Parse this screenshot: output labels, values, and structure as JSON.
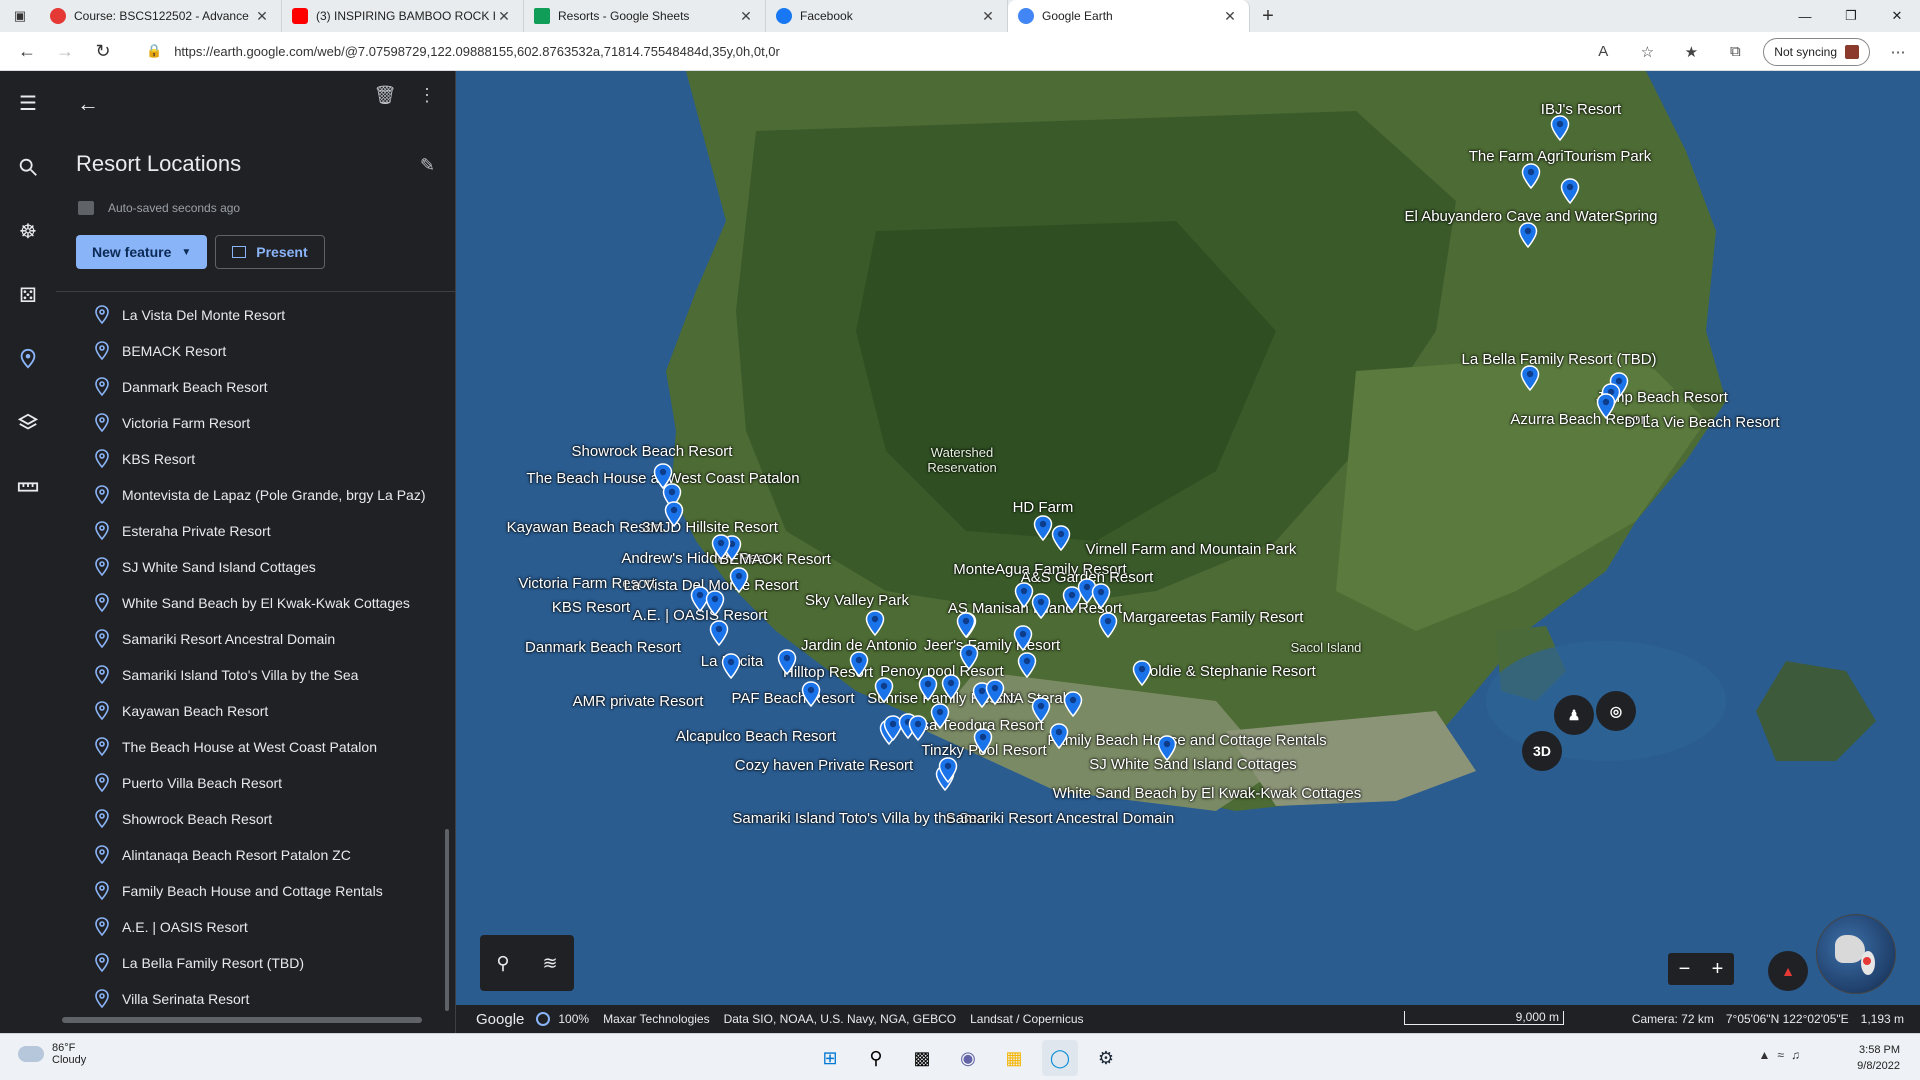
{
  "browser": {
    "tabs": [
      {
        "title": "Course: BSCS122502 - Advance",
        "favicon_color": "#e53935"
      },
      {
        "title": "(3) INSPIRING BAMBOO ROCK H",
        "favicon_color": "#ff0000"
      },
      {
        "title": "Resorts - Google Sheets",
        "favicon_color": "#0f9d58"
      },
      {
        "title": "Facebook",
        "favicon_color": "#1877f2"
      },
      {
        "title": "Google Earth",
        "favicon_color": "#4285f4"
      }
    ],
    "url": "https://earth.google.com/web/@7.07598729,122.09888155,602.8763532a,71814.75548484d,35y,0h,0t,0r",
    "sync_label": "Not syncing"
  },
  "panel": {
    "project_title": "Resort Locations",
    "autosave": "Auto-saved seconds ago",
    "new_feature_label": "New feature",
    "present_label": "Present",
    "features": [
      "La Vista Del Monte Resort",
      "BEMACK Resort",
      "Danmark Beach Resort",
      "Victoria Farm Resort",
      "KBS Resort",
      "Montevista de Lapaz (Pole Grande, brgy La Paz)",
      "Esteraha Private Resort",
      "SJ White Sand Island Cottages",
      "White Sand Beach by El Kwak-Kwak Cottages",
      "Samariki Resort Ancestral Domain",
      "Samariki Island Toto's Villa by the Sea",
      "Kayawan Beach Resort",
      "The Beach House at West Coast Patalon",
      "Puerto Villa Beach Resort",
      "Showrock Beach Resort",
      "Alintanaqa Beach Resort Patalon ZC",
      "Family Beach House and Cottage Rentals",
      "A.E. | OASIS Resort",
      "La Bella Family Resort (TBD)",
      "Villa Serinata Resort"
    ]
  },
  "map": {
    "labels": [
      "IBJ's Resort",
      "The Farm AgriTourism Park",
      "El Abuyandero Cave and WaterSpring",
      "La Bella Family Resort (TBD)",
      "Jemp Beach Resort",
      "Azurra Beach Resort",
      "D' La Vie Beach Resort",
      "Showrock Beach Resort",
      "The Beach House at West Coast Patalon",
      "Kayawan Beach Resort",
      "3MJD Hillsite Resort",
      "Andrew's Hidden Resort",
      "BEMACK Resort",
      "HD Farm",
      "Virnell Farm and Mountain Park",
      "MonteAgua Family Resort",
      "A&S Garden Resort",
      "Victoria Farm Resort",
      "La Vista Del Monte Resort",
      "Sky Valley Park",
      "AS Manisan Inland Resort",
      "Margareetas Family Resort",
      "KBS Resort",
      "A.E. | OASIS Resort",
      "Danmark Beach Resort",
      "Jardin de Antonio",
      "Jeer's Family Resort",
      "La Pacita",
      "Hilltop Resort",
      "Penoy pool Resort",
      "Goldie & Stephanie Resort",
      "AMR private Resort",
      "PAF Beach Resort",
      "Sunrise Family Resort",
      "SNA Steraha",
      "Alcapulco Beach Resort",
      "Casa Teodora Resort",
      "Family Beach House and Cottage Rentals",
      "Tinzky Pool Resort",
      "SJ White Sand Island Cottages",
      "Cozy haven Private Resort",
      "White Sand Beach by El Kwak-Kwak Cottages",
      "Samariki Island Toto's Villa by the Sea",
      "Samariki Resort Ancestral Domain"
    ],
    "region_labels": [
      "Watershed",
      "Reservation",
      "Sacol Island"
    ],
    "btn_3d": "3D",
    "pin_color": "#1a73e8"
  },
  "status": {
    "google": "Google",
    "zoom": "100%",
    "credits": [
      "Maxar Technologies",
      "Data SIO, NOAA, U.S. Navy, NGA, GEBCO",
      "Landsat / Copernicus"
    ],
    "scale": "9,000 m",
    "camera": "Camera: 72 km",
    "coords": "7°05'06\"N 122°02'05\"E",
    "elevation": "1,193 m"
  },
  "taskbar": {
    "temp": "86°F",
    "condition": "Cloudy",
    "time": "3:58 PM",
    "date": "9/8/2022"
  }
}
